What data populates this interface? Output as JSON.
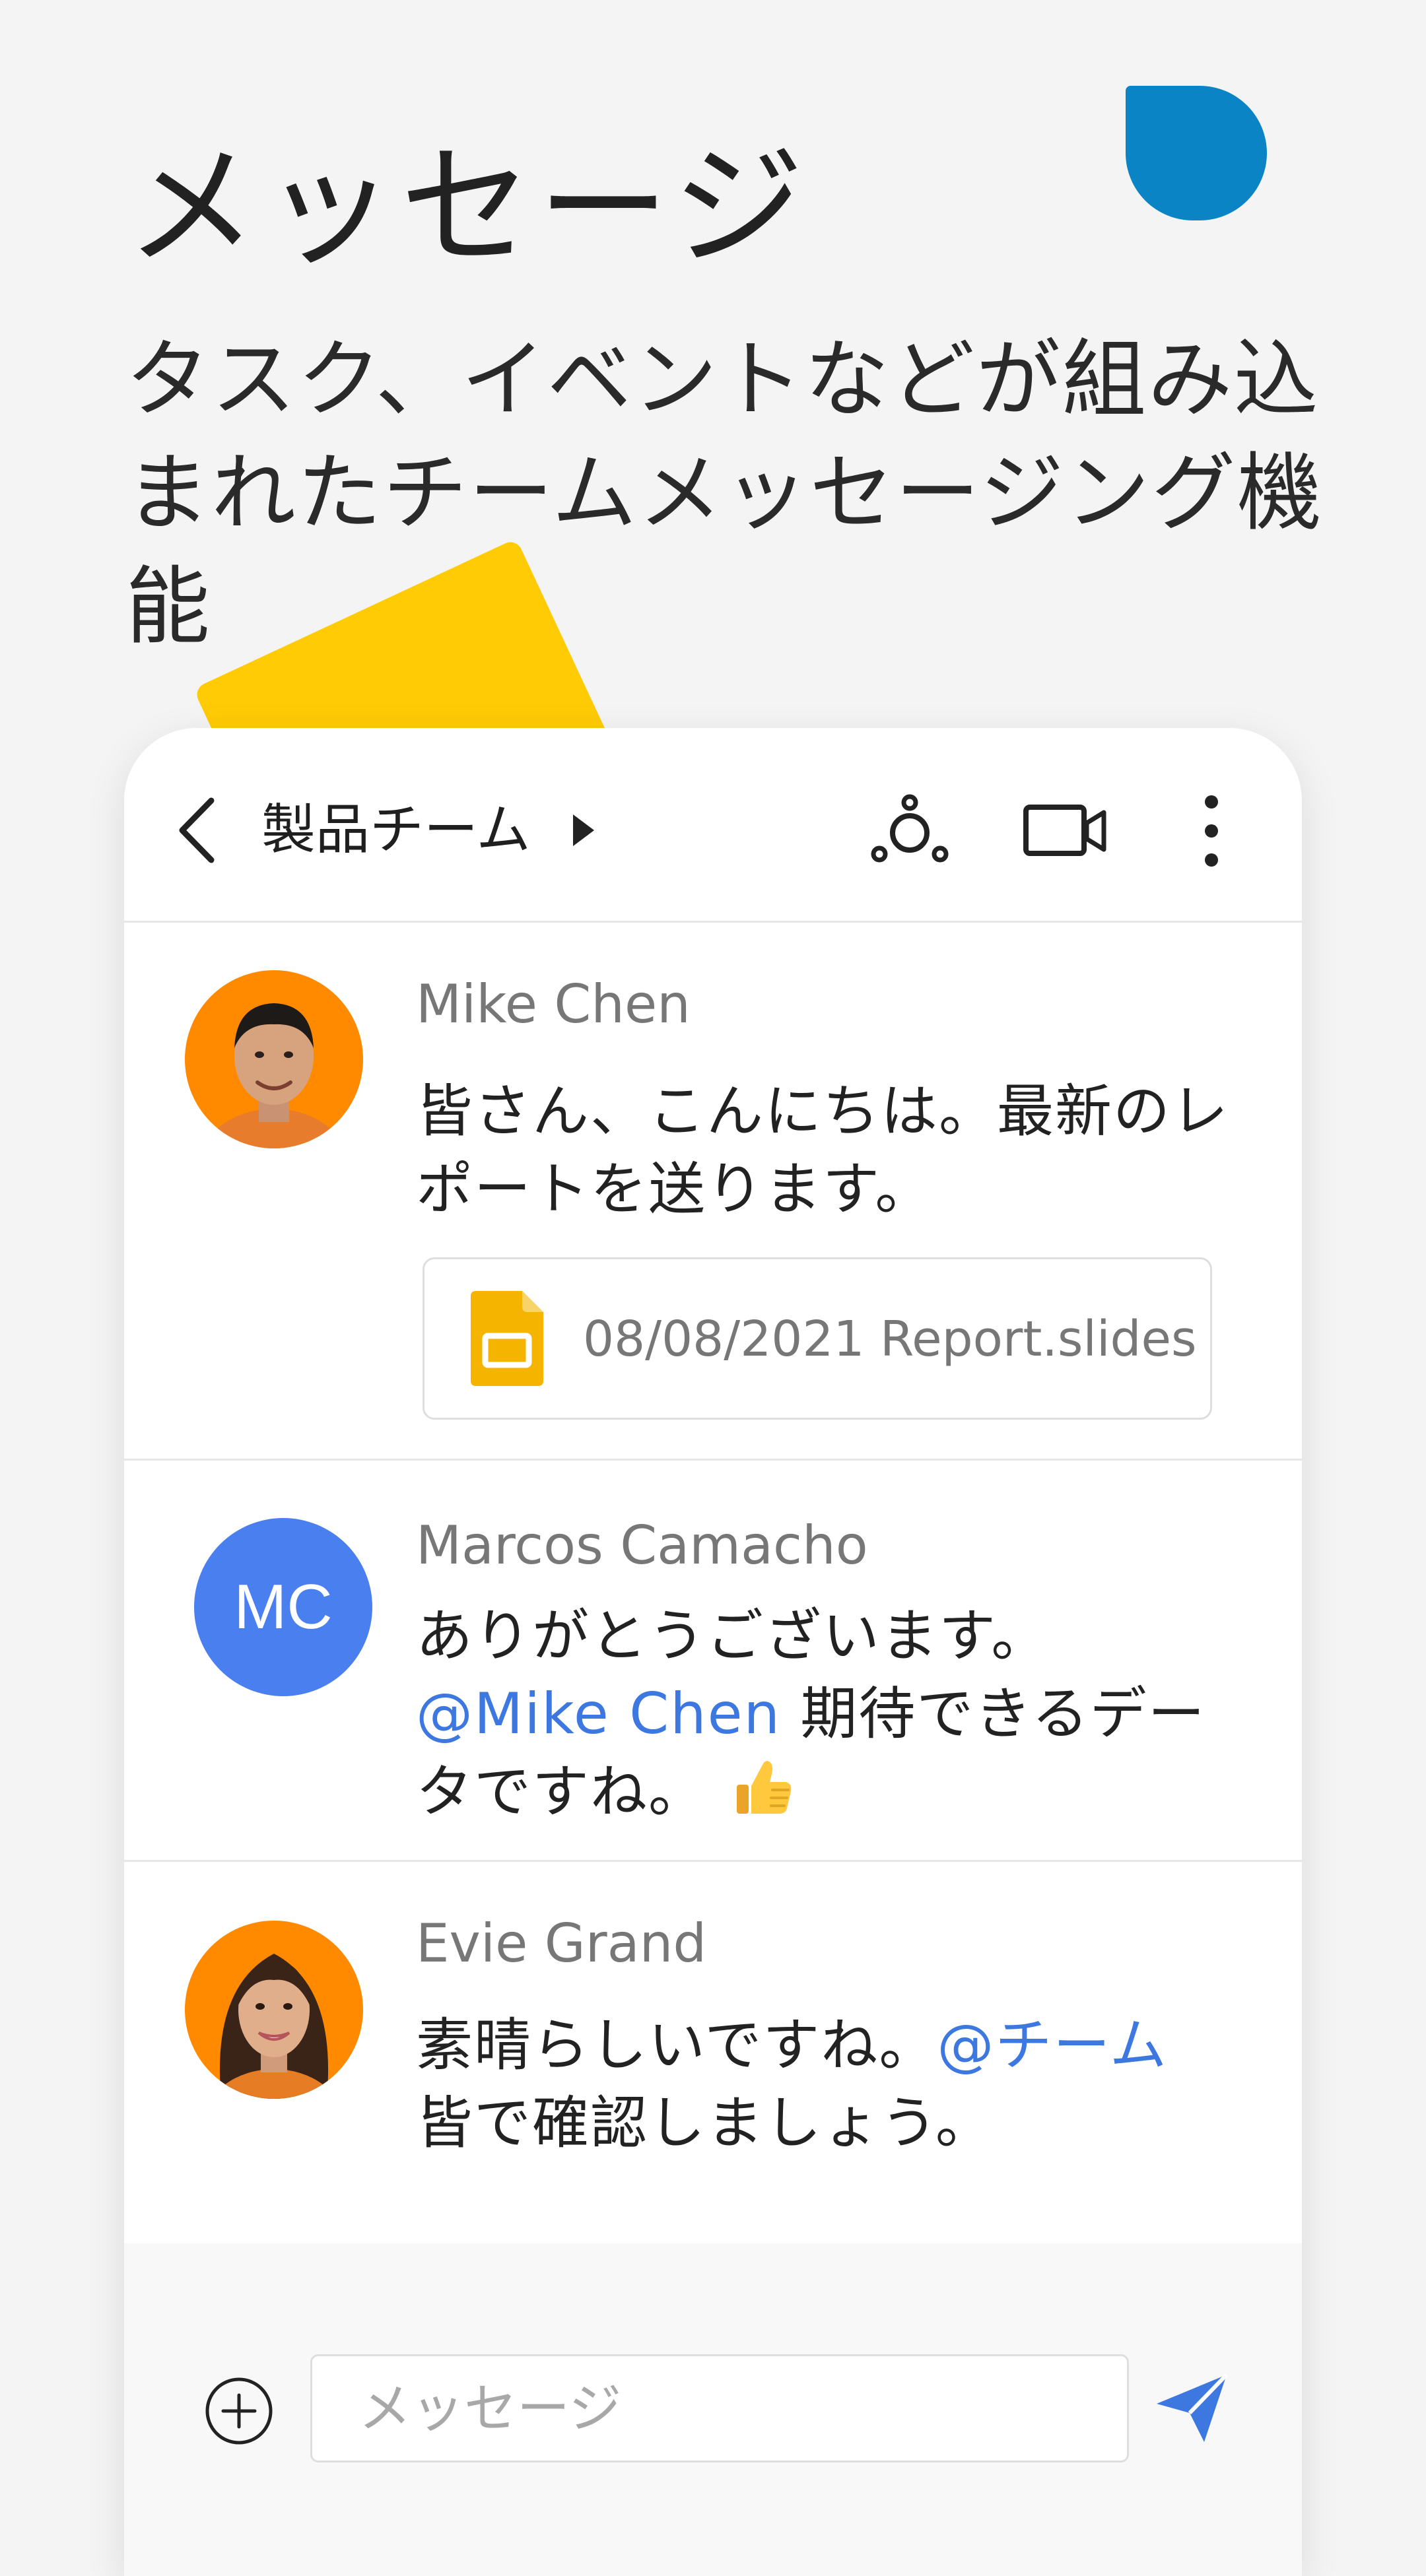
{
  "hero": {
    "title": "メッセージ",
    "subtitle": "タスク、イベントなどが組み込まれたチームメッセージング機能"
  },
  "colors": {
    "accent_blue": "#0b84c6",
    "accent_yellow": "#ffcb05",
    "mention": "#3d78e0",
    "avatar_orange": "#ff8a00",
    "avatar_mc": "#4a7ff0"
  },
  "header": {
    "back_icon": "chevron-left-icon",
    "title": "製品チーム",
    "caret_icon": "caret-right-icon",
    "actions": [
      "people-icon",
      "video-camera-icon",
      "more-vert-icon"
    ]
  },
  "messages": [
    {
      "sender": "Mike Chen",
      "avatar": "photo",
      "text": "皆さん、こんにちは。最新のレポートを送ります。",
      "attachment": {
        "icon": "slides-file-icon",
        "name": "08/08/2021 Report.slides"
      }
    },
    {
      "sender": "Marcos Camacho",
      "avatar_initials": "MC",
      "text_before": "ありがとうございます。",
      "mention": "@Mike Chen",
      "text_after": " 期待できるデータですね。",
      "emoji": "thumbs-up-icon"
    },
    {
      "sender": "Evie Grand",
      "avatar": "photo",
      "text_before": "素晴らしいですね。",
      "mention": "@チーム",
      "text_after": "皆で確認しましょう。"
    }
  ],
  "composer": {
    "add_icon": "add-circle-icon",
    "placeholder": "メッセージ",
    "value": "",
    "send_icon": "send-icon"
  }
}
